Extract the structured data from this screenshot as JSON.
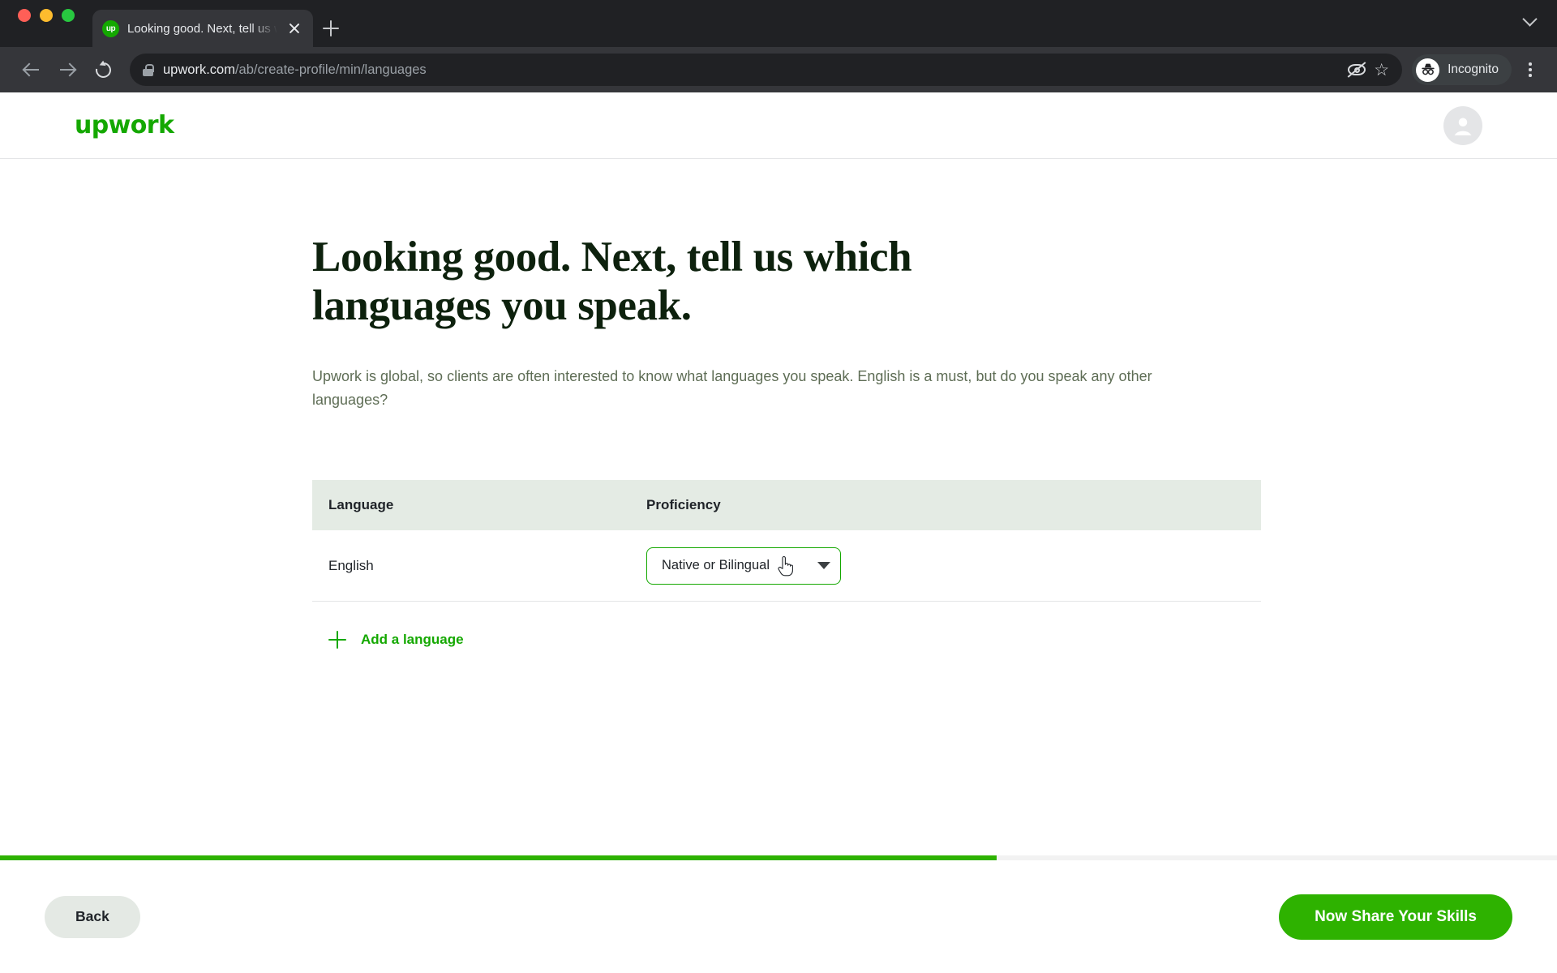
{
  "browser": {
    "tab": {
      "title": "Looking good. Next, tell us whi",
      "favicon_text": "up",
      "favicon_name": "upwork-favicon",
      "close_icon": "close-icon"
    },
    "new_tab_icon": "plus-icon",
    "tabstrip_chevron_icon": "chevron-down-icon",
    "nav": {
      "back_icon": "arrow-left-icon",
      "forward_icon": "arrow-right-icon",
      "reload_icon": "reload-icon"
    },
    "omnibox": {
      "lock_icon": "lock-icon",
      "url_host": "upwork.com",
      "url_path": "/ab/create-profile/min/languages",
      "full_url": "upwork.com/ab/create-profile/min/languages"
    },
    "actions": {
      "tracking_protection_icon": "eye-off-icon",
      "bookmark_icon": "star-icon",
      "bookmark_glyph": "☆",
      "incognito_label": "Incognito",
      "incognito_icon": "incognito-hat-icon",
      "menu_icon": "kebab-menu-icon"
    }
  },
  "site_header": {
    "logo_text": "upwork",
    "avatar_icon": "user-avatar-icon"
  },
  "main": {
    "headline": "Looking good. Next, tell us which languages you speak.",
    "subtext": "Upwork is global, so clients are often interested to know what languages you speak. English is a must, but do you speak any other languages?",
    "table": {
      "columns": [
        "Language",
        "Proficiency"
      ],
      "rows": [
        {
          "language": "English",
          "proficiency": "Native or Bilingual"
        }
      ]
    },
    "add_language": {
      "label": "Add a language",
      "icon": "plus-icon"
    },
    "cursor_icon": "pointing-hand-cursor"
  },
  "footer": {
    "progress_percent": 64,
    "back_label": "Back",
    "primary_label": "Now Share Your Skills"
  },
  "colors": {
    "upwork_green": "#14a800",
    "button_green": "#2eb200",
    "headline_dark": "#0d210d",
    "table_header_bg": "#e4ebe4",
    "back_button_bg": "#e4e9e4"
  }
}
